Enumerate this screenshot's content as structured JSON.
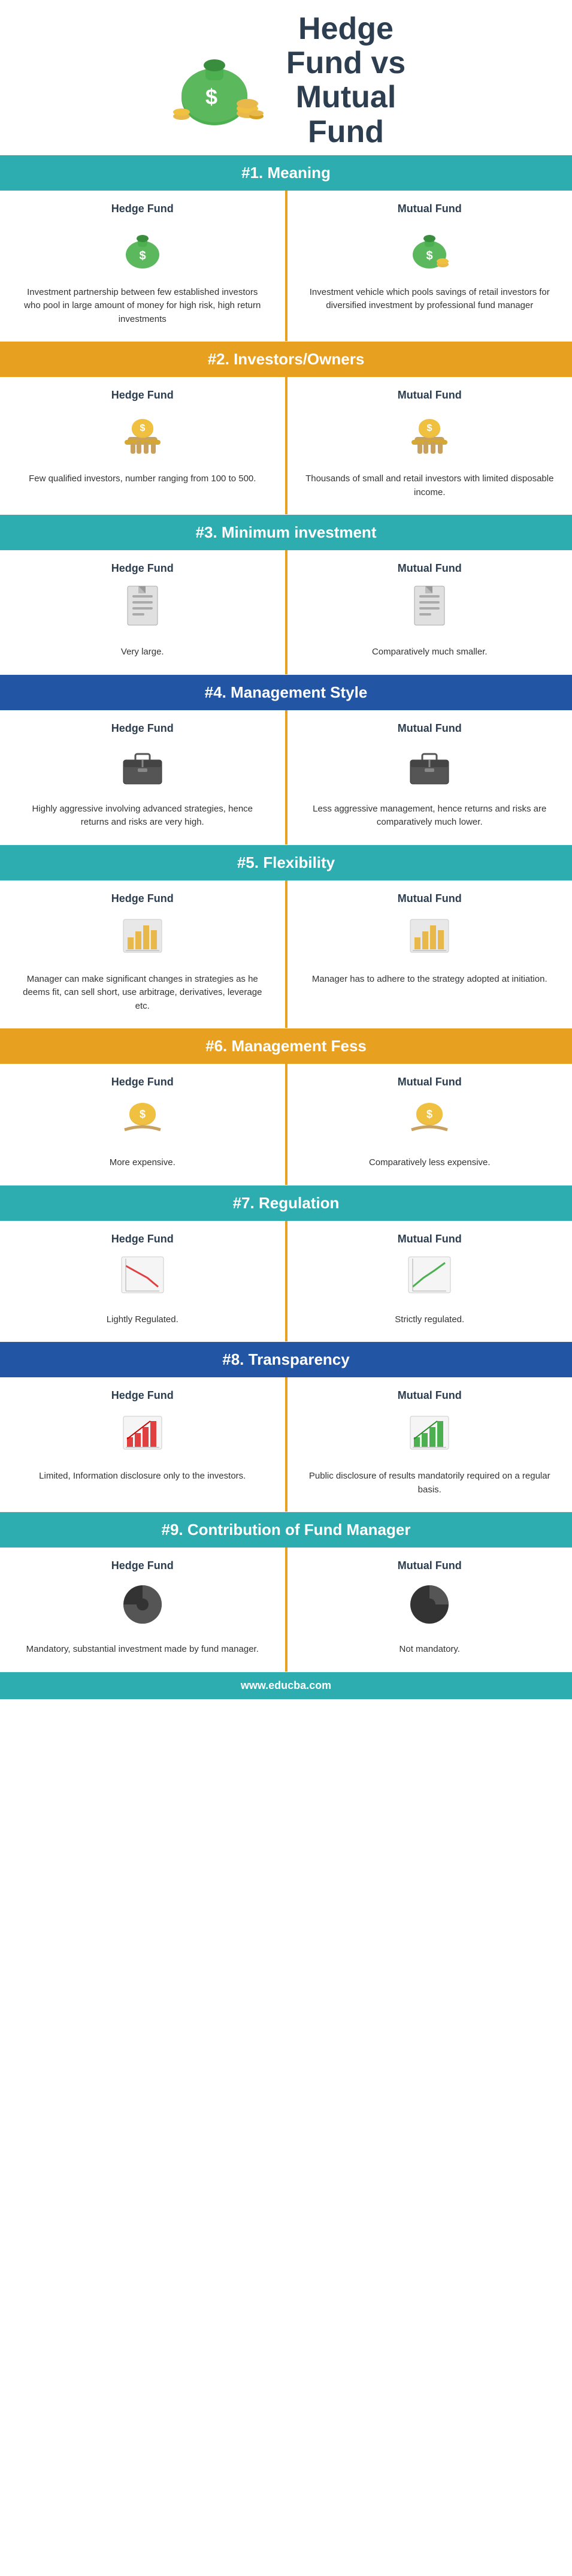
{
  "header": {
    "title_line1": "Hedge",
    "title_line2": "Fund vs",
    "title_line3": "Mutual",
    "title_line4": "Fund"
  },
  "sections": [
    {
      "id": "meaning",
      "number": "#1.",
      "title": "Meaning",
      "color": "teal",
      "left": {
        "label": "Hedge Fund",
        "icon": "money-bag",
        "text": "Investment partnership between few established investors who pool in large amount of money for high risk, high return investments"
      },
      "right": {
        "label": "Mutual Fund",
        "icon": "money-coins",
        "text": "Investment vehicle which pools savings of retail investors for diversified investment by professional fund manager"
      }
    },
    {
      "id": "investors",
      "number": "#2.",
      "title": "Investors/Owners",
      "color": "orange",
      "left": {
        "label": "Hedge Fund",
        "icon": "hand-coins",
        "text": "Few qualified investors, number ranging from 100 to 500."
      },
      "right": {
        "label": "Mutual Fund",
        "icon": "hand-coins2",
        "text": "Thousands of small and retail investors with limited disposable income."
      }
    },
    {
      "id": "minimum",
      "number": "#3.",
      "title": "Minimum investment",
      "color": "teal",
      "left": {
        "label": "Hedge Fund",
        "icon": "document",
        "text": "Very large."
      },
      "right": {
        "label": "Mutual Fund",
        "icon": "document",
        "text": "Comparatively much smaller."
      }
    },
    {
      "id": "management",
      "number": "#4.",
      "title": "Management Style",
      "color": "blue",
      "left": {
        "label": "Hedge Fund",
        "icon": "briefcase",
        "text": "Highly aggressive involving advanced strategies, hence returns and risks are very high."
      },
      "right": {
        "label": "Mutual Fund",
        "icon": "briefcase",
        "text": "Less aggressive management, hence returns and risks are comparatively much lower."
      }
    },
    {
      "id": "flexibility",
      "number": "#5.",
      "title": "Flexibility",
      "color": "teal",
      "left": {
        "label": "Hedge Fund",
        "icon": "bar-chart",
        "text": "Manager can make significant changes in strategies as he deems fit, can sell short, use arbitrage, derivatives, leverage etc."
      },
      "right": {
        "label": "Mutual Fund",
        "icon": "bar-chart",
        "text": "Manager has to adhere to the strategy adopted at initiation."
      }
    },
    {
      "id": "fees",
      "number": "#6.",
      "title": "Management Fess",
      "color": "orange",
      "left": {
        "label": "Hedge Fund",
        "icon": "money-hand",
        "text": "More expensive."
      },
      "right": {
        "label": "Mutual Fund",
        "icon": "money-hand2",
        "text": "Comparatively less expensive."
      }
    },
    {
      "id": "regulation",
      "number": "#7.",
      "title": "Regulation",
      "color": "teal",
      "left": {
        "label": "Hedge Fund",
        "icon": "chart-down",
        "text": "Lightly Regulated."
      },
      "right": {
        "label": "Mutual Fund",
        "icon": "chart-up",
        "text": "Strictly regulated."
      }
    },
    {
      "id": "transparency",
      "number": "#8.",
      "title": "Transparency",
      "color": "blue",
      "left": {
        "label": "Hedge Fund",
        "icon": "bar-up",
        "text": "Limited, Information disclosure only to the investors."
      },
      "right": {
        "label": "Mutual Fund",
        "icon": "bar-up2",
        "text": "Public disclosure of results mandatorily required on a regular basis."
      }
    },
    {
      "id": "contribution",
      "number": "#9.",
      "title": "Contribution of Fund Manager",
      "color": "teal",
      "left": {
        "label": "Hedge Fund",
        "icon": "pie-chart",
        "text": "Mandatory, substantial investment made by fund manager."
      },
      "right": {
        "label": "Mutual Fund",
        "icon": "pie-chart2",
        "text": "Not mandatory."
      }
    }
  ],
  "footer": {
    "url": "www.educba.com"
  }
}
